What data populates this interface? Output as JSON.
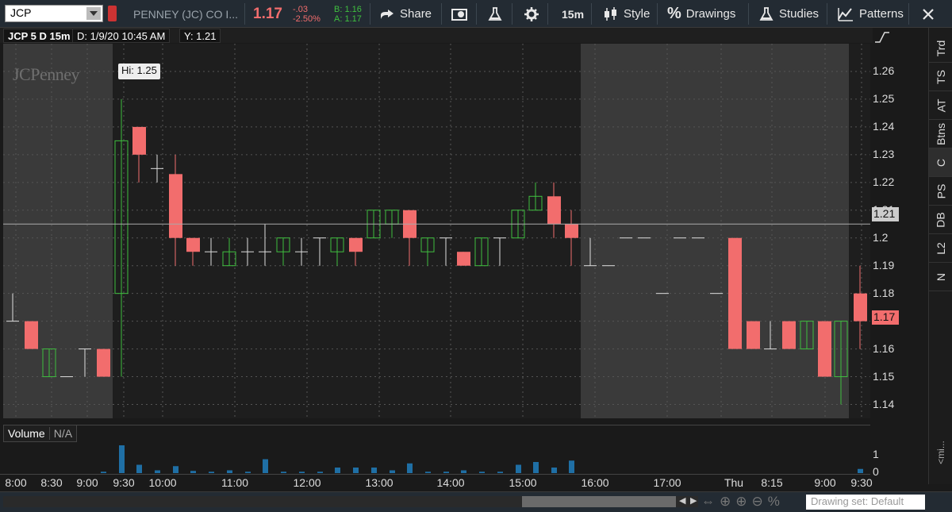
{
  "toolbar": {
    "symbol": "JCP",
    "company": "PENNEY (JC) CO I...",
    "last": "1.17",
    "change": "-.03",
    "change_pct": "-2.50%",
    "bid": "B: 1.16",
    "ask": "A: 1.17",
    "share_label": "Share",
    "timeframe": "15m",
    "style_label": "Style",
    "drawings_label": "Drawings",
    "studies_label": "Studies",
    "patterns_label": "Patterns"
  },
  "chart_header": {
    "title": "JCP 5 D 15m",
    "date": "D: 1/9/20 10:45 AM",
    "y": "Y: 1.21",
    "logo": "JCPenney",
    "hi_label": "Hi: 1.25"
  },
  "volume_header": {
    "label": "Volume",
    "value": "N/A"
  },
  "price_tags": {
    "crosshair": "1.21",
    "last": "1.17"
  },
  "y_ticks": [
    "1.26",
    "1.25",
    "1.24",
    "1.23",
    "1.22",
    "1.21",
    "1.2",
    "1.19",
    "1.18",
    "1.17",
    "1.16",
    "1.15",
    "1.14"
  ],
  "x_ticks": [
    "8:00",
    "8:30",
    "9:00",
    "9:30",
    "10:00",
    "11:00",
    "12:00",
    "13:00",
    "14:00",
    "15:00",
    "16:00",
    "17:00",
    "Thu",
    "8:15",
    "9:00",
    "9:30"
  ],
  "volume_ticks": [
    "1",
    "0"
  ],
  "right_tabs": [
    "Trd",
    "TS",
    "AT",
    "Btns",
    "C",
    "PS",
    "DB",
    "L2",
    "N"
  ],
  "right_more": "<mi...",
  "bottom": {
    "drawing_set": "Drawing set: Default"
  },
  "colors": {
    "up": "#3fbf3f",
    "down": "#f26d6d",
    "flat": "#dddddd",
    "bg_session": "#1e1e1e",
    "bg_ext": "#3a3a3a",
    "volume": "#1f6fa5"
  },
  "chart_data": {
    "type": "candlestick",
    "title": "JCP 5 D 15m",
    "ylim": [
      1.135,
      1.27
    ],
    "candles": [
      {
        "t": "7:45",
        "o": 1.17,
        "h": 1.18,
        "l": 1.17,
        "c": 1.17,
        "v": 0
      },
      {
        "t": "8:00",
        "o": 1.17,
        "h": 1.17,
        "l": 1.16,
        "c": 1.16,
        "v": 0
      },
      {
        "t": "8:15",
        "o": 1.15,
        "h": 1.16,
        "l": 1.15,
        "c": 1.16,
        "v": 0
      },
      {
        "t": "8:30",
        "o": 1.15,
        "h": 1.15,
        "l": 1.15,
        "c": 1.15,
        "v": 0
      },
      {
        "t": "8:45",
        "o": 1.16,
        "h": 1.16,
        "l": 1.15,
        "c": 1.16,
        "v": 0
      },
      {
        "t": "9:00",
        "o": 1.16,
        "h": 1.16,
        "l": 1.15,
        "c": 1.15,
        "v": 0.05
      },
      {
        "t": "9:30",
        "o": 1.18,
        "h": 1.25,
        "l": 1.15,
        "c": 1.235,
        "v": 1
      },
      {
        "t": "9:45",
        "o": 1.24,
        "h": 1.24,
        "l": 1.22,
        "c": 1.23,
        "v": 0.3
      },
      {
        "t": "10:00",
        "o": 1.225,
        "h": 1.23,
        "l": 1.22,
        "c": 1.225,
        "v": 0.1
      },
      {
        "t": "10:15",
        "o": 1.223,
        "h": 1.23,
        "l": 1.19,
        "c": 1.2,
        "v": 0.25
      },
      {
        "t": "10:30",
        "o": 1.2,
        "h": 1.2,
        "l": 1.19,
        "c": 1.195,
        "v": 0.08
      },
      {
        "t": "10:45",
        "o": 1.195,
        "h": 1.2,
        "l": 1.19,
        "c": 1.195,
        "v": 0.05
      },
      {
        "t": "11:00",
        "o": 1.19,
        "h": 1.2,
        "l": 1.19,
        "c": 1.195,
        "v": 0.1
      },
      {
        "t": "11:15",
        "o": 1.195,
        "h": 1.2,
        "l": 1.19,
        "c": 1.195,
        "v": 0.05
      },
      {
        "t": "11:30",
        "o": 1.195,
        "h": 1.205,
        "l": 1.19,
        "c": 1.195,
        "v": 0.5
      },
      {
        "t": "11:45",
        "o": 1.195,
        "h": 1.2,
        "l": 1.19,
        "c": 1.2,
        "v": 0.05
      },
      {
        "t": "12:00",
        "o": 1.195,
        "h": 1.2,
        "l": 1.19,
        "c": 1.195,
        "v": 0.05
      },
      {
        "t": "12:15",
        "o": 1.2,
        "h": 1.2,
        "l": 1.19,
        "c": 1.2,
        "v": 0.05
      },
      {
        "t": "12:30",
        "o": 1.195,
        "h": 1.2,
        "l": 1.19,
        "c": 1.2,
        "v": 0.2
      },
      {
        "t": "12:45",
        "o": 1.2,
        "h": 1.2,
        "l": 1.19,
        "c": 1.195,
        "v": 0.2
      },
      {
        "t": "13:00",
        "o": 1.2,
        "h": 1.21,
        "l": 1.2,
        "c": 1.21,
        "v": 0.2
      },
      {
        "t": "13:15",
        "o": 1.205,
        "h": 1.21,
        "l": 1.2,
        "c": 1.21,
        "v": 0.1
      },
      {
        "t": "13:30",
        "o": 1.21,
        "h": 1.21,
        "l": 1.19,
        "c": 1.2,
        "v": 0.35
      },
      {
        "t": "13:45",
        "o": 1.195,
        "h": 1.2,
        "l": 1.19,
        "c": 1.2,
        "v": 0.05
      },
      {
        "t": "14:00",
        "o": 1.2,
        "h": 1.2,
        "l": 1.19,
        "c": 1.2,
        "v": 0.05
      },
      {
        "t": "14:15",
        "o": 1.195,
        "h": 1.195,
        "l": 1.19,
        "c": 1.19,
        "v": 0.1
      },
      {
        "t": "14:30",
        "o": 1.19,
        "h": 1.2,
        "l": 1.19,
        "c": 1.2,
        "v": 0.05
      },
      {
        "t": "14:45",
        "o": 1.2,
        "h": 1.2,
        "l": 1.19,
        "c": 1.2,
        "v": 0.05
      },
      {
        "t": "15:00",
        "o": 1.2,
        "h": 1.21,
        "l": 1.2,
        "c": 1.21,
        "v": 0.3
      },
      {
        "t": "15:15",
        "o": 1.21,
        "h": 1.22,
        "l": 1.21,
        "c": 1.215,
        "v": 0.4
      },
      {
        "t": "15:30",
        "o": 1.215,
        "h": 1.22,
        "l": 1.2,
        "c": 1.205,
        "v": 0.2
      },
      {
        "t": "15:45",
        "o": 1.205,
        "h": 1.21,
        "l": 1.19,
        "c": 1.2,
        "v": 0.45
      },
      {
        "t": "16:00",
        "o": 1.19,
        "h": 1.2,
        "l": 1.19,
        "c": 1.19,
        "v": 0
      },
      {
        "t": "16:15",
        "o": 1.19,
        "h": 1.19,
        "l": 1.19,
        "c": 1.19,
        "v": 0
      },
      {
        "t": "16:30",
        "o": 1.2,
        "h": 1.2,
        "l": 1.2,
        "c": 1.2,
        "v": 0
      },
      {
        "t": "16:45",
        "o": 1.2,
        "h": 1.2,
        "l": 1.2,
        "c": 1.2,
        "v": 0
      },
      {
        "t": "17:00",
        "o": 1.18,
        "h": 1.18,
        "l": 1.18,
        "c": 1.18,
        "v": 0
      },
      {
        "t": "17:15",
        "o": 1.2,
        "h": 1.2,
        "l": 1.2,
        "c": 1.2,
        "v": 0
      },
      {
        "t": "17:30",
        "o": 1.2,
        "h": 1.2,
        "l": 1.2,
        "c": 1.2,
        "v": 0
      },
      {
        "t": "17:45",
        "o": 1.18,
        "h": 1.18,
        "l": 1.18,
        "c": 1.18,
        "v": 0
      },
      {
        "t": "Thu 8:00",
        "o": 1.2,
        "h": 1.2,
        "l": 1.16,
        "c": 1.16,
        "v": 0
      },
      {
        "t": "8:15",
        "o": 1.17,
        "h": 1.17,
        "l": 1.16,
        "c": 1.16,
        "v": 0
      },
      {
        "t": "8:30",
        "o": 1.16,
        "h": 1.17,
        "l": 1.16,
        "c": 1.16,
        "v": 0
      },
      {
        "t": "8:45",
        "o": 1.17,
        "h": 1.17,
        "l": 1.16,
        "c": 1.16,
        "v": 0
      },
      {
        "t": "9:00",
        "o": 1.16,
        "h": 1.17,
        "l": 1.16,
        "c": 1.17,
        "v": 0
      },
      {
        "t": "9:15",
        "o": 1.17,
        "h": 1.17,
        "l": 1.15,
        "c": 1.15,
        "v": 0
      },
      {
        "t": "9:20",
        "o": 1.15,
        "h": 1.17,
        "l": 1.14,
        "c": 1.17,
        "v": 0
      },
      {
        "t": "9:30",
        "o": 1.18,
        "h": 1.19,
        "l": 1.16,
        "c": 1.17,
        "v": 0.15
      }
    ]
  }
}
